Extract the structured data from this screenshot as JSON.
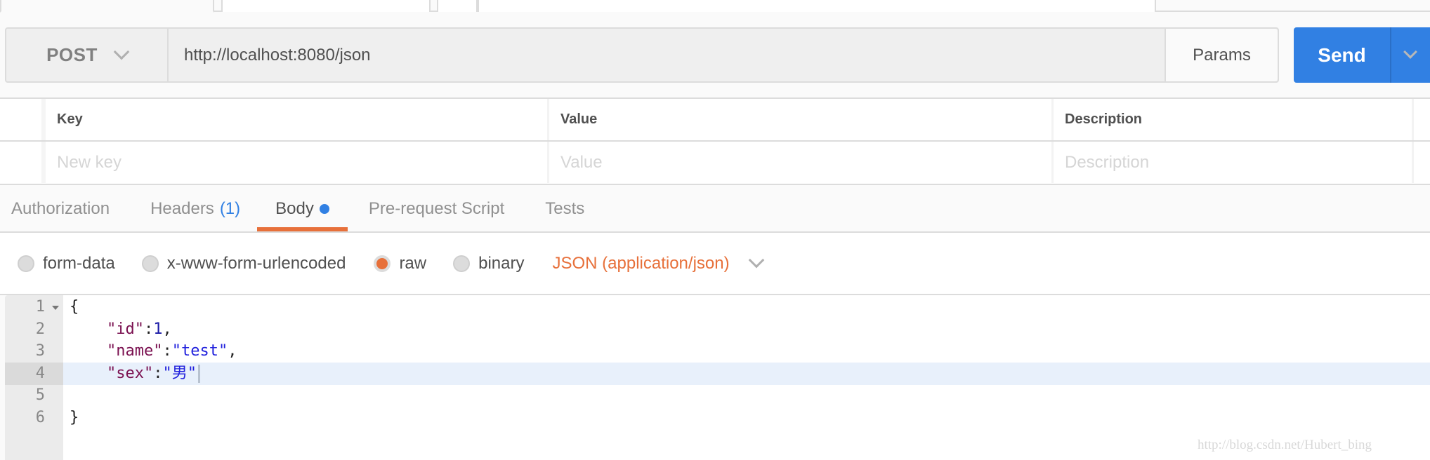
{
  "request": {
    "method": "POST",
    "url": "http://localhost:8080/json",
    "params_label": "Params",
    "send_label": "Send"
  },
  "params_table": {
    "headers": {
      "key": "Key",
      "value": "Value",
      "description": "Description"
    },
    "placeholders": {
      "key": "New key",
      "value": "Value",
      "description": "Description"
    }
  },
  "tabs": [
    {
      "label": "Authorization"
    },
    {
      "label": "Headers",
      "count": "(1)"
    },
    {
      "label": "Body",
      "active": true,
      "modified": true
    },
    {
      "label": "Pre-request Script"
    },
    {
      "label": "Tests"
    }
  ],
  "body_modes": [
    {
      "label": "form-data",
      "checked": false
    },
    {
      "label": "x-www-form-urlencoded",
      "checked": false
    },
    {
      "label": "raw",
      "checked": true
    },
    {
      "label": "binary",
      "checked": false
    }
  ],
  "content_type": "JSON (application/json)",
  "editor": {
    "active_line": 4,
    "lines": [
      {
        "n": "1",
        "tokens": [
          {
            "t": "{",
            "c": "p"
          }
        ],
        "fold": true
      },
      {
        "n": "2",
        "tokens": [
          {
            "t": "    ",
            "c": "p"
          },
          {
            "t": "\"id\"",
            "c": "key"
          },
          {
            "t": ":",
            "c": "p"
          },
          {
            "t": "1",
            "c": "num"
          },
          {
            "t": ",",
            "c": "p"
          }
        ]
      },
      {
        "n": "3",
        "tokens": [
          {
            "t": "    ",
            "c": "p"
          },
          {
            "t": "\"name\"",
            "c": "key"
          },
          {
            "t": ":",
            "c": "p"
          },
          {
            "t": "\"test\"",
            "c": "str"
          },
          {
            "t": ",",
            "c": "p"
          }
        ]
      },
      {
        "n": "4",
        "tokens": [
          {
            "t": "    ",
            "c": "p"
          },
          {
            "t": "\"sex\"",
            "c": "key"
          },
          {
            "t": ":",
            "c": "p"
          },
          {
            "t": "\"男\"",
            "c": "str"
          }
        ],
        "cursor": true
      },
      {
        "n": "5",
        "tokens": []
      },
      {
        "n": "6",
        "tokens": [
          {
            "t": "}",
            "c": "p"
          }
        ]
      }
    ]
  },
  "watermark": "http://blog.csdn.net/Hubert_bing",
  "colors": {
    "accent_orange": "#e7703a",
    "send_blue": "#3180e3",
    "json_key": "#7a1050",
    "json_string": "#2222dd",
    "json_number": "#1a1aa6"
  }
}
